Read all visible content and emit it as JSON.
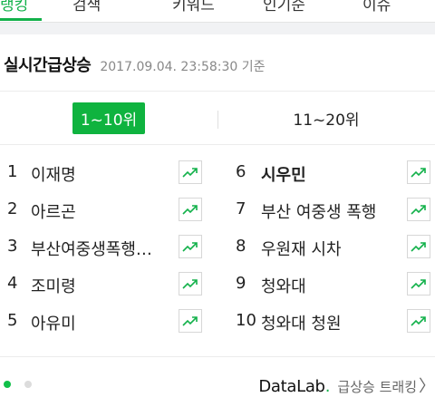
{
  "nav": {
    "tabs": [
      {
        "label": "랭킹",
        "active": true
      },
      {
        "label": "검색",
        "active": false
      },
      {
        "label": "키워드",
        "active": false
      },
      {
        "label": "인기순",
        "active": false
      },
      {
        "label": "이슈",
        "active": false
      }
    ]
  },
  "panel": {
    "title": "실시간급상승",
    "timestamp": "2017.09.04. 23:58:30 기준"
  },
  "range_tabs": [
    {
      "label": "1~10위",
      "selected": true
    },
    {
      "label": "11~20위",
      "selected": false
    }
  ],
  "ranks_left": [
    {
      "rank": "1",
      "keyword": "이재명"
    },
    {
      "rank": "2",
      "keyword": "아르곤"
    },
    {
      "rank": "3",
      "keyword": "부산여중생폭행사건"
    },
    {
      "rank": "4",
      "keyword": "조미령"
    },
    {
      "rank": "5",
      "keyword": "아유미"
    }
  ],
  "ranks_right": [
    {
      "rank": "6",
      "keyword": "시우민"
    },
    {
      "rank": "7",
      "keyword": "부산 여중생 폭행"
    },
    {
      "rank": "8",
      "keyword": "우원재 시차"
    },
    {
      "rank": "9",
      "keyword": "청와대"
    },
    {
      "rank": "10",
      "keyword": "청와대 청원"
    }
  ],
  "footer": {
    "brand": "DataLab",
    "brand_dot": ".",
    "link": "급상승 트래킹",
    "chevron": "〉"
  },
  "icons": {
    "trend": "trend-up-icon"
  },
  "colors": {
    "accent": "#12b14a",
    "tab_selected_bg": "#0fb33f",
    "dot_inactive": "#dcdcdc"
  }
}
